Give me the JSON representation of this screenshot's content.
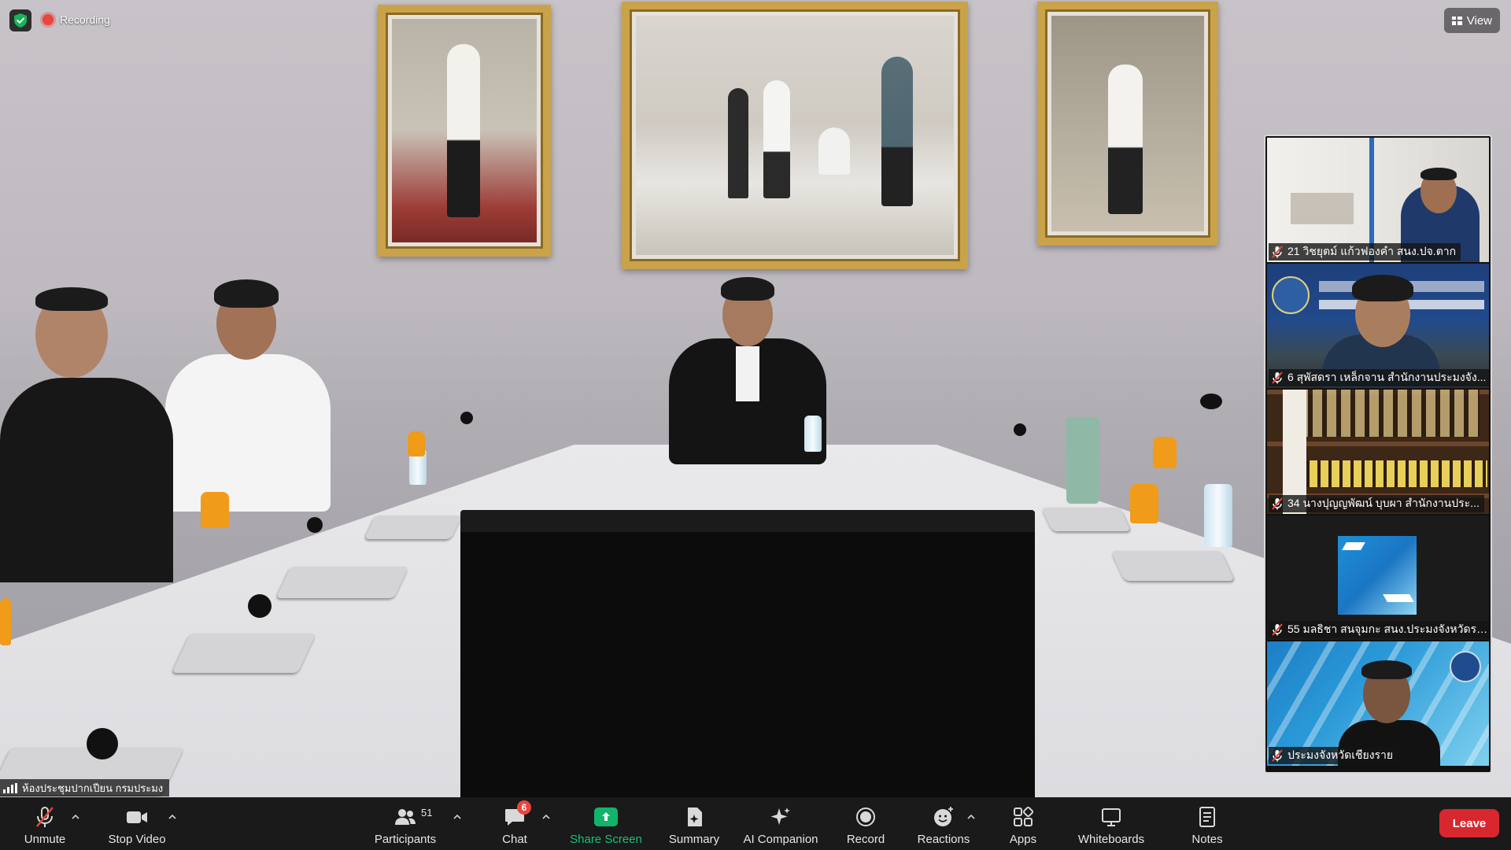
{
  "top_bar": {
    "recording_label": "Recording",
    "view_label": "View"
  },
  "main_video": {
    "room_name": "ห้องประชุมปากเปียน กรมประมง"
  },
  "gallery": [
    {
      "name": "21 วิชยุตม์ แก้วฟองคำ สนง.ปจ.ตาก"
    },
    {
      "name": "6 สุพัสดรา เหล็กจาน สำนักงานประมงจัง..."
    },
    {
      "name": "34 นางปุญญพัฒน์  บุบผา สำนักงานประ..."
    },
    {
      "name": "55 มลธิชา สนจุมกะ สนง.ประมงจังหวัดระ..."
    },
    {
      "name": "ประมงจังหวัดเชียงราย"
    }
  ],
  "toolbar": {
    "unmute": "Unmute",
    "stop_video": "Stop Video",
    "participants": "Participants",
    "participants_count": "51",
    "chat": "Chat",
    "chat_badge": "6",
    "share_screen": "Share Screen",
    "summary": "Summary",
    "ai_companion": "AI Companion",
    "record": "Record",
    "reactions": "Reactions",
    "apps": "Apps",
    "whiteboards": "Whiteboards",
    "notes": "Notes",
    "leave": "Leave"
  },
  "colors": {
    "toolbar_bg": "#1a1a1a",
    "leave_red": "#d8272e",
    "share_green": "#12b36b",
    "recording_red": "#e8463f",
    "mute_red": "#e8463f"
  },
  "icons": [
    "shield-check-icon",
    "recording-dot-icon",
    "view-grid-icon",
    "signal-icon",
    "mic-off-icon",
    "video-camera-icon",
    "participants-icon",
    "chat-icon",
    "share-screen-icon",
    "summary-icon",
    "ai-companion-icon",
    "record-icon",
    "reactions-icon",
    "apps-icon",
    "whiteboards-icon",
    "notes-icon",
    "chevron-up-icon"
  ]
}
